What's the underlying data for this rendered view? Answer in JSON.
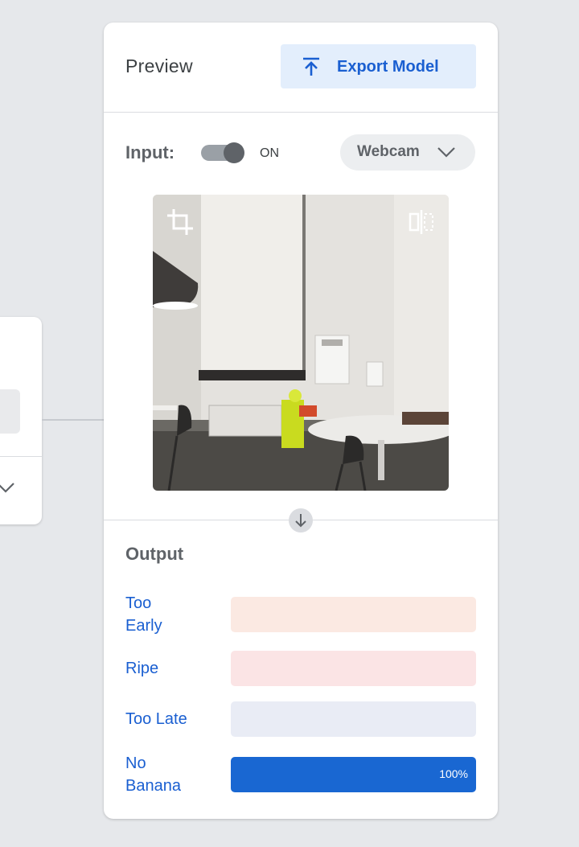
{
  "header": {
    "title": "Preview",
    "export_label": "Export Model"
  },
  "input": {
    "label": "Input:",
    "toggle_state": "ON",
    "toggle_on": true,
    "source": "Webcam"
  },
  "output": {
    "title": "Output",
    "classes": [
      {
        "name_line1": "Too",
        "name_line2": "Early",
        "confidence": 0,
        "pct_label": "",
        "track_color": "#fbe9e2",
        "fill_color": "#e8710a"
      },
      {
        "name_line1": "Ripe",
        "name_line2": "",
        "confidence": 0,
        "pct_label": "",
        "track_color": "#fbe4e5",
        "fill_color": "#d93025"
      },
      {
        "name_line1": "Too Late",
        "name_line2": "",
        "confidence": 0,
        "pct_label": "",
        "track_color": "#e9ecf5",
        "fill_color": "#5c6bc0"
      },
      {
        "name_line1": "No",
        "name_line2": "Banana",
        "confidence": 1.0,
        "pct_label": "100%",
        "track_color": "#dbe7fb",
        "fill_color": "#1967d2"
      }
    ]
  },
  "colors": {
    "accent": "#1a5fd1",
    "export_bg": "#e3eefc"
  }
}
